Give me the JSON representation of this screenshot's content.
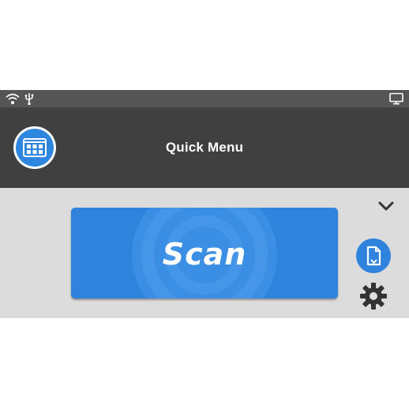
{
  "header": {
    "title": "Quick Menu"
  },
  "main": {
    "scan_label": "Scan"
  },
  "icons": {
    "status": [
      "wifi-icon",
      "usb-icon",
      "display-icon"
    ],
    "menu": "grid-apps-icon",
    "expand": "chevron-down-icon",
    "document": "document-feed-icon",
    "settings": "gear-icon"
  },
  "colors": {
    "accent": "#2f83dc",
    "header_bg": "#404040",
    "status_bg": "#555555",
    "main_bg": "#dcdcdc"
  }
}
